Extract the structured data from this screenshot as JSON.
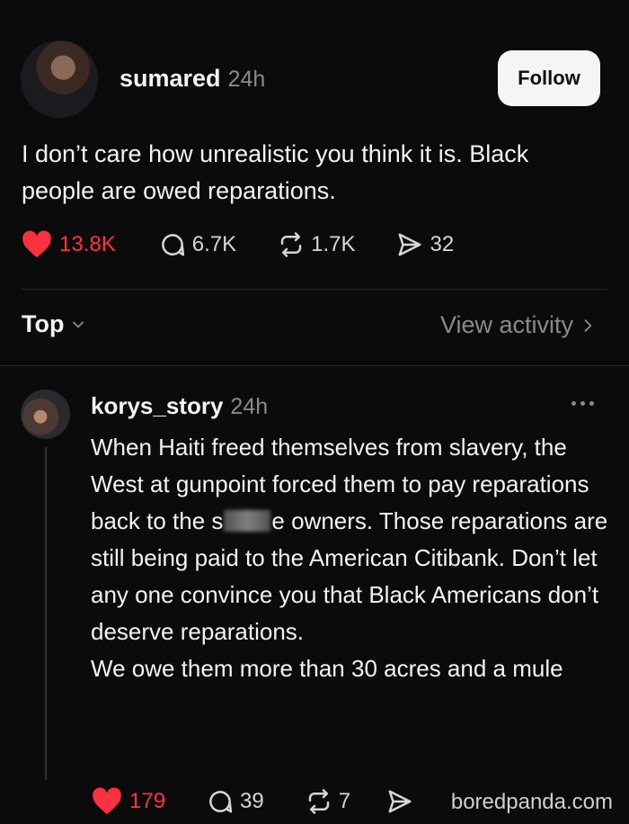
{
  "post": {
    "username": "sumared",
    "time": "24h",
    "follow_label": "Follow",
    "text": "I don’t care how unrealistic you think it is. Black people are owed reparations.",
    "likes": "13.8K",
    "comments": "6.7K",
    "reposts": "1.7K",
    "shares": "32"
  },
  "sort": {
    "label": "Top",
    "view_activity": "View activity"
  },
  "reply": {
    "username": "korys_story",
    "time": "24h",
    "text_before_redaction": "When Haiti freed themselves from slavery, the West at gunpoint forced them to pay reparations back to the s",
    "text_after_redaction": "e owners. Those reparations are still being paid to the American Citibank. Don’t let any one convince you that Black Americans don’t deserve reparations.",
    "text_line_2": "We owe them more than 30 acres and a mule",
    "likes": "179",
    "comments": "39",
    "reposts": "7"
  },
  "watermark": "boredpanda.com",
  "colors": {
    "background": "#0b0b0b",
    "like_red": "#ff3040",
    "muted_gray": "#8a8a8a",
    "text_white": "#f3f3f3"
  },
  "icons": [
    "heart-filled-icon",
    "comment-bubble-icon",
    "repost-icon",
    "send-icon",
    "chevron-down-icon",
    "chevron-right-icon",
    "more-dots-icon"
  ]
}
